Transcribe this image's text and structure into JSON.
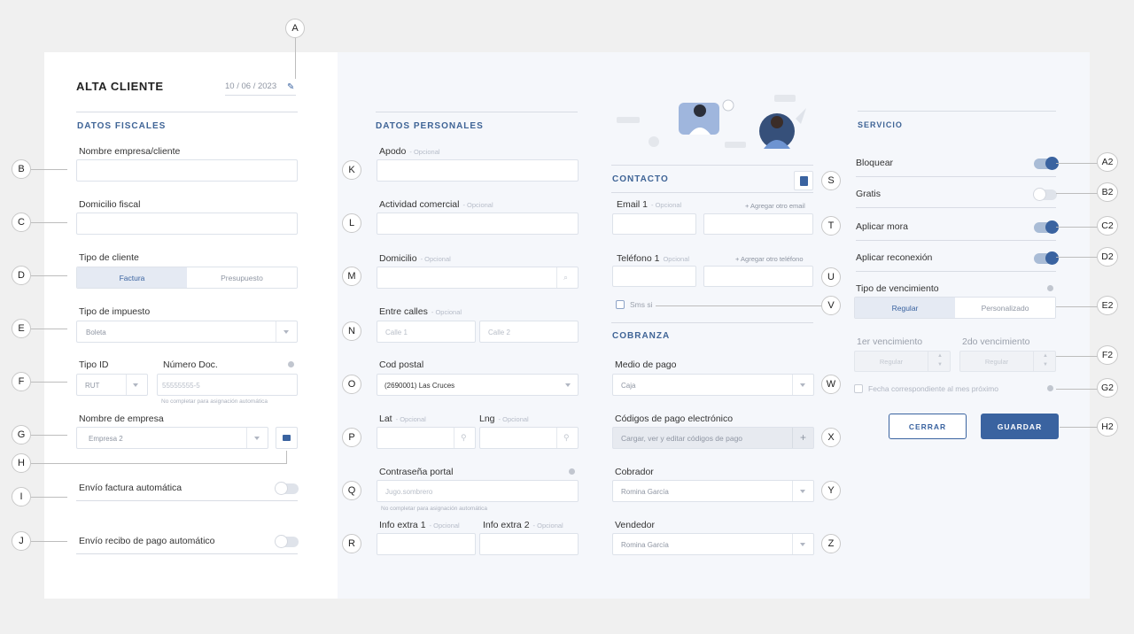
{
  "header": {
    "title": "ALTA CLIENTE",
    "date": "10 / 06 / 2023"
  },
  "fiscales": {
    "section": "DATOS FISCALES",
    "nombre_label": "Nombre empresa/cliente",
    "domicilio_label": "Domicilio fiscal",
    "tipo_cliente_label": "Tipo de cliente",
    "tipo_cliente_options": [
      "Factura",
      "Presupuesto"
    ],
    "impuesto_label": "Tipo de impuesto",
    "impuesto_value": "Boleta",
    "tipo_id_label": "Tipo ID",
    "tipo_id_value": "RUT",
    "numero_doc_label": "Número Doc.",
    "numero_doc_placeholder": "55555555-5",
    "numero_doc_hint": "No completar para asignación automática",
    "empresa_label": "Nombre de empresa",
    "empresa_value": "Empresa 2",
    "envio_factura": "Envío factura automática",
    "envio_recibo": "Envío recibo de pago automático"
  },
  "personales": {
    "section": "DATOS PERSONALES",
    "optional": "- Opcional",
    "apodo_label": "Apodo",
    "actividad_label": "Actividad comercial",
    "domicilio_label": "Domicilio",
    "entre_calles_label": "Entre calles",
    "calle1_placeholder": "Calle 1",
    "calle2_placeholder": "Calle 2",
    "cod_postal_label": "Cod postal",
    "cod_postal_value": "(2690001) Las Cruces",
    "lat_label": "Lat",
    "lng_label": "Lng",
    "contrasena_label": "Contraseña portal",
    "contrasena_placeholder": "Jugo.sombrero",
    "contrasena_hint": "No completar para asignación automática",
    "info1_label": "Info extra 1",
    "info2_label": "Info extra 2"
  },
  "contacto": {
    "section": "CONTACTO",
    "email_label": "Email 1",
    "email_optional": "- Opcional",
    "add_email": "+ Agregar otro email",
    "telefono_label": "Teléfono 1",
    "telefono_optional": "Opcional",
    "add_telefono": "+ Agregar otro teléfono",
    "sms_label": "Sms si"
  },
  "cobranza": {
    "section": "COBRANZA",
    "medio_label": "Medio de pago",
    "medio_value": "Caja",
    "codigos_label": "Códigos de pago electrónico",
    "codigos_placeholder": "Cargar, ver y editar códigos de pago",
    "cobrador_label": "Cobrador",
    "cobrador_value": "Romina García",
    "vendedor_label": "Vendedor",
    "vendedor_value": "Romina García"
  },
  "servicio": {
    "section": "SERVICIO",
    "bloquear": "Bloquear",
    "gratis": "Gratis",
    "mora": "Aplicar mora",
    "reconexion": "Aplicar  reconexión",
    "toggles": {
      "bloquear": true,
      "gratis": false,
      "mora": true,
      "reconexion": true
    },
    "vencimiento_label": "Tipo de vencimiento",
    "vencimiento_options": [
      "Regular",
      "Personalizado"
    ],
    "primer_venc": "1er vencimiento",
    "segundo_venc": "2do vencimiento",
    "venc_placeholder": "Regular",
    "fecha_proximo": "Fecha correspondiente al mes próximo",
    "cerrar": "CERRAR",
    "guardar": "GUARDAR"
  },
  "callouts": [
    "A",
    "B",
    "C",
    "D",
    "E",
    "F",
    "G",
    "H",
    "I",
    "J",
    "K",
    "L",
    "M",
    "N",
    "O",
    "P",
    "Q",
    "R",
    "S",
    "T",
    "U",
    "V",
    "W",
    "X",
    "Y",
    "Z",
    "A2",
    "B2",
    "C2",
    "D2",
    "E2",
    "F2",
    "G2",
    "H2"
  ],
  "colors": {
    "accent": "#3a63a0",
    "panel": "#f5f7fb",
    "background": "#f0f0f0"
  }
}
